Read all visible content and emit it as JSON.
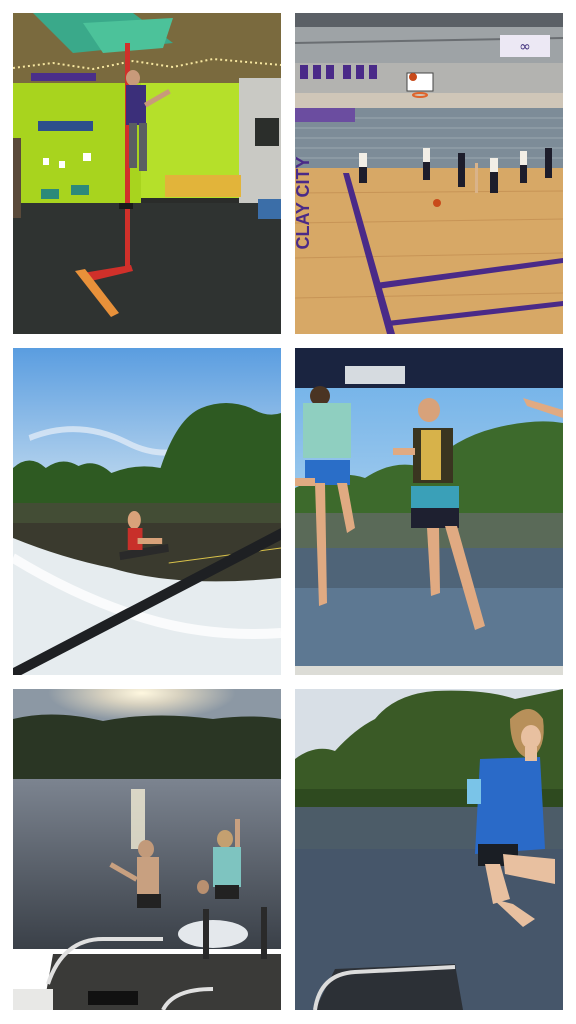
{
  "collage": {
    "photos": [
      {
        "name": "climbing-wall-museum",
        "wall_text": ""
      },
      {
        "name": "gym-basketball-practice",
        "court_text": "CLAY CITY",
        "logo": "infinity-logo"
      },
      {
        "name": "lake-wakeboarding"
      },
      {
        "name": "kids-jumping-from-boat"
      },
      {
        "name": "sunset-lake-jump"
      },
      {
        "name": "girl-jumping-into-lake"
      }
    ]
  }
}
